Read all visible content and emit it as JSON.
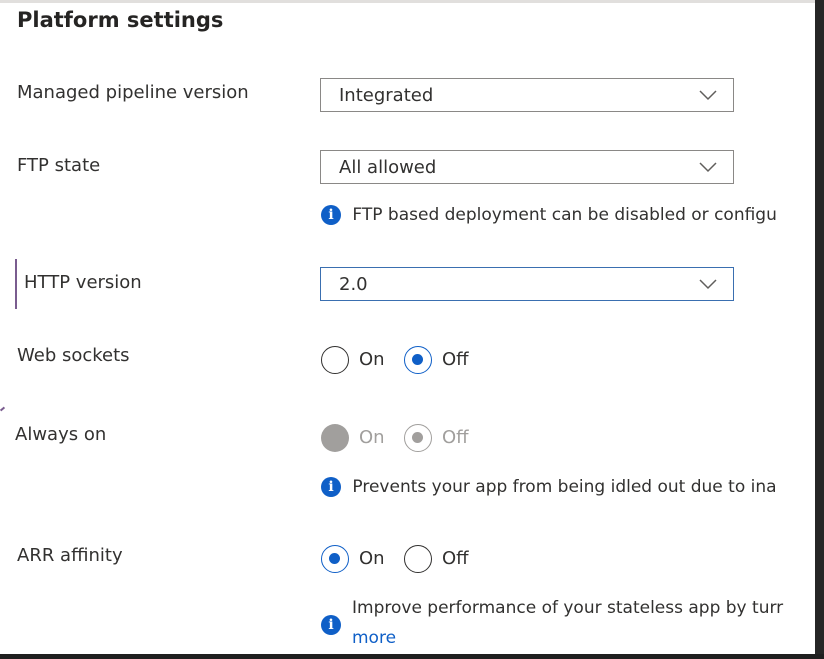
{
  "page": {
    "title": "Platform settings"
  },
  "settings": {
    "pipeline": {
      "label": "Managed pipeline version",
      "value": "Integrated"
    },
    "ftp": {
      "label": "FTP state",
      "value": "All allowed",
      "info": "FTP based deployment can be disabled or configu"
    },
    "http": {
      "label": "HTTP version",
      "value": "2.0"
    },
    "websockets": {
      "label": "Web sockets",
      "on": "On",
      "off": "Off",
      "selected": "Off"
    },
    "always_on": {
      "label": "Always on",
      "on": "On",
      "off": "Off",
      "selected": "Off",
      "disabled": true,
      "info": "Prevents your app from being idled out due to ina"
    },
    "arr": {
      "label": "ARR affinity",
      "on": "On",
      "off": "Off",
      "selected": "On",
      "info": "Improve performance of your stateless app by turr",
      "link": "more"
    }
  },
  "icons": {
    "info": "info-circle-icon",
    "chevron": "chevron-down-icon"
  },
  "colors": {
    "accent": "#0f5fc7",
    "disabled": "#a19f9d",
    "border": "#8a8886"
  }
}
